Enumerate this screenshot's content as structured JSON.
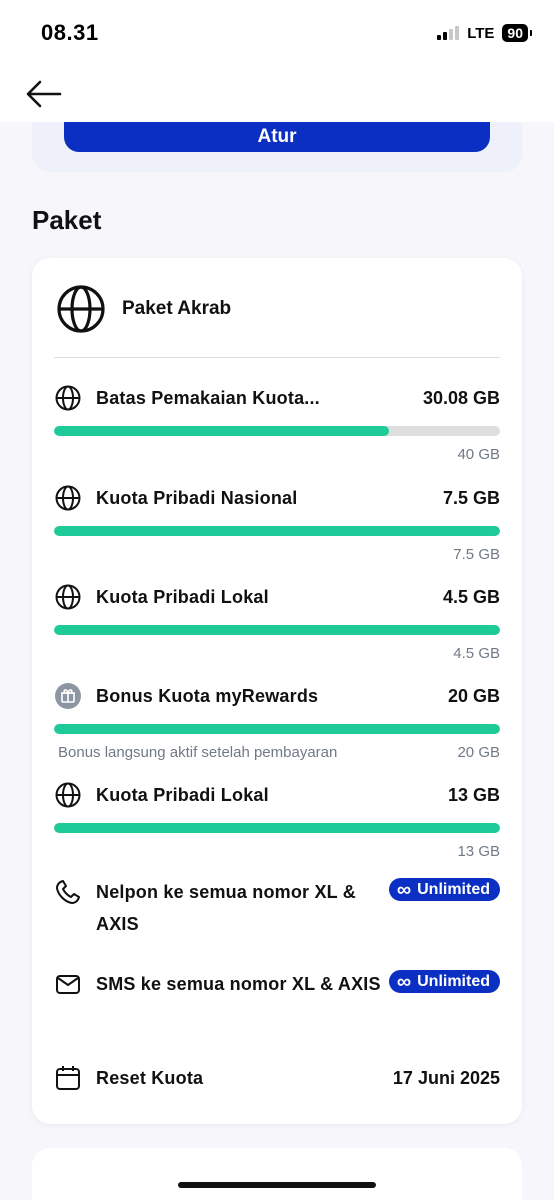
{
  "status_bar": {
    "time": "08.31",
    "network": "LTE",
    "battery": "90"
  },
  "top_card": {
    "button_label": "Atur"
  },
  "section": {
    "title": "Paket"
  },
  "package": {
    "name": "Paket Akrab",
    "quotas": [
      {
        "name": "Batas Pemakaian Kuota...",
        "value": "30.08 GB",
        "total": "40 GB",
        "note": "",
        "fill_fraction": 0.752,
        "icon": "globe-icon"
      },
      {
        "name": "Kuota Pribadi Nasional",
        "value": "7.5 GB",
        "total": "7.5 GB",
        "note": "",
        "fill_fraction": 1.0,
        "icon": "globe-icon"
      },
      {
        "name": "Kuota Pribadi Lokal",
        "value": "4.5 GB",
        "total": "4.5 GB",
        "note": "",
        "fill_fraction": 1.0,
        "icon": "globe-icon"
      },
      {
        "name": "Bonus Kuota myRewards",
        "value": "20 GB",
        "total": "20 GB",
        "note": "Bonus langsung aktif setelah pembayaran",
        "fill_fraction": 1.0,
        "icon": "gift-icon"
      },
      {
        "name": "Kuota Pribadi Lokal",
        "value": "13 GB",
        "total": "13 GB",
        "note": "",
        "fill_fraction": 1.0,
        "icon": "globe-icon"
      }
    ],
    "unlimited": [
      {
        "name": "Nelpon ke semua nomor XL & AXIS",
        "badge": "Unlimited",
        "icon": "phone-icon"
      },
      {
        "name": "SMS ke semua nomor XL & AXIS",
        "badge": "Unlimited",
        "icon": "envelope-icon"
      }
    ],
    "reset": {
      "label": "Reset Kuota",
      "date": "17 Juni 2025",
      "icon": "calendar-icon"
    }
  },
  "colors": {
    "accent": "#0a2fc2",
    "progress": "#1ecb98",
    "track": "#dedede",
    "muted_text": "#707a86"
  }
}
